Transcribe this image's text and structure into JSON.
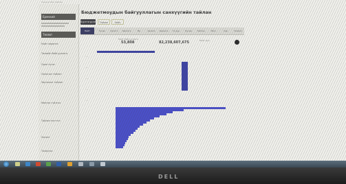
{
  "page": {
    "title": "Бюджетмоудын байгууллагын санхүүгийн тайлан",
    "breadcrumb": "Санхүүгийн тайлан"
  },
  "toolbar": {
    "primary_label": "Бүртгэгдсэн",
    "secondary_label": "Тайлан",
    "tertiary_label": "Хайх"
  },
  "tabs": [
    "Нийт",
    "Төсөв",
    "Орлого",
    "Зарлага",
    "Өр",
    "Авлага",
    "Хөрөнгө",
    "Үр дүн",
    "Бусад",
    "Тайлан",
    "Жил",
    "Сар",
    "Улирал"
  ],
  "stats": {
    "value_left": "53,808",
    "value_right": "82,238,607,675",
    "caption_left": "Нийт байгууллага",
    "caption_right": "Нийт дүн"
  },
  "sidebar": {
    "items": [
      "Ерөнхий",
      "Төсөвт",
      "Нийт хөрөнгө",
      "Төсвийн байгууллага",
      "Орон нутаг",
      "Орлогын тайлан",
      "Зарлагын тайлан",
      "Мөнгөн гүйлгээ",
      "Тайлан нэгтгэл",
      "Хяналт",
      "Тохиргоо"
    ]
  },
  "colors": {
    "accent": "#3e44a2",
    "bar": "#4b50c9",
    "tab_active": "#3d3f66"
  },
  "chart_data": {
    "type": "bar",
    "orientation": "horizontal",
    "values": [
      100,
      62,
      52,
      46,
      40,
      35,
      31,
      28,
      25,
      22,
      20,
      18,
      16,
      14,
      12,
      11,
      10,
      9,
      8,
      7
    ]
  }
}
